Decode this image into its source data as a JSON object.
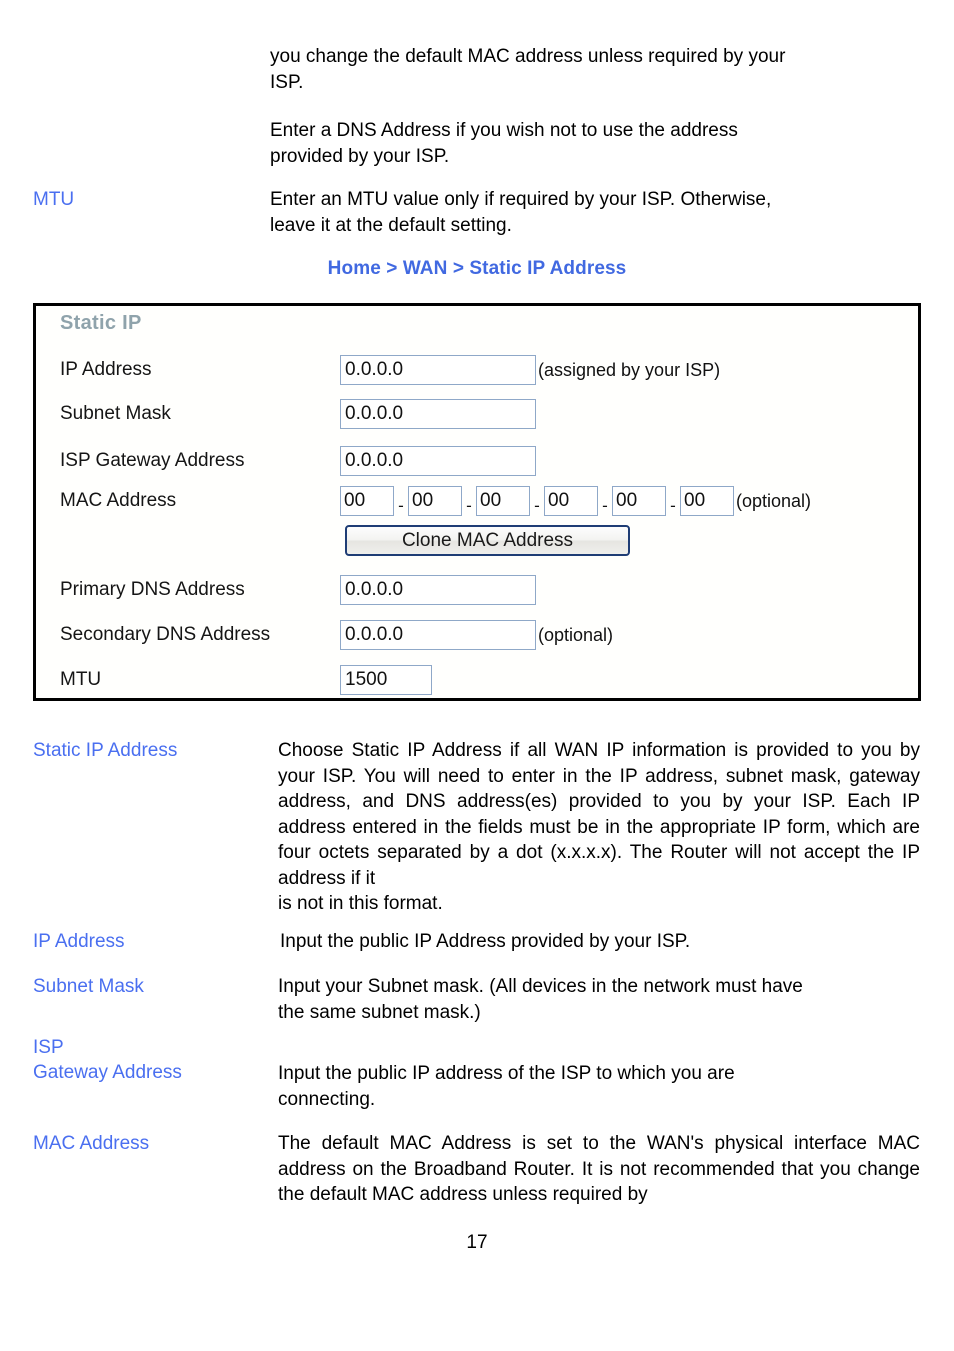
{
  "document": {
    "page_number": "17",
    "accent_term_color": "#4a6ff0",
    "breadcrumb_color": "#4169e1",
    "panel_title_color": "#8fa3ab",
    "input_border_color": "#8fa8c8",
    "button_border_color": "#1f3d75"
  },
  "top_paragraphs": [
    {
      "body": "you change the default MAC address unless required by your",
      "last_line": "ISP."
    },
    {
      "body": "Enter a DNS Address if you wish not to use the address",
      "last_line": "provided by    your ISP."
    }
  ],
  "mtu_row": {
    "term": "MTU",
    "body": "Enter an MTU value only if required by your ISP. Otherwise,",
    "last_line": "leave it at the default setting."
  },
  "breadcrumb": "Home > WAN > Static IP Address",
  "panel": {
    "title": "Static IP",
    "rows": {
      "ip_address": {
        "label": "IP Address",
        "value": "0.0.0.0",
        "note": "(assigned by your ISP)"
      },
      "subnet_mask": {
        "label": "Subnet Mask",
        "value": "0.0.0.0",
        "note": ""
      },
      "isp_gateway_address": {
        "label": "ISP Gateway Address",
        "value": "0.0.0.0",
        "note": ""
      },
      "mac_address": {
        "label": "MAC Address",
        "octets": [
          "00",
          "00",
          "00",
          "00",
          "00",
          "00"
        ],
        "separator": "-",
        "note": "(optional)"
      },
      "clone_mac_button": "Clone MAC Address",
      "primary_dns_address": {
        "label": "Primary DNS Address",
        "value": "0.0.0.0",
        "note": ""
      },
      "secondary_dns_address": {
        "label": "Secondary DNS Address",
        "value": "0.0.0.0",
        "note": "(optional)"
      },
      "mtu": {
        "label": "MTU",
        "value": "1500",
        "note": ""
      }
    }
  },
  "descriptions": [
    {
      "term": "Static IP Address",
      "body": "Choose Static IP Address if all WAN IP information is provided to you by your ISP. You will need to enter in the IP address, subnet mask, gateway address, and DNS address(es) provided to you by your ISP. Each IP address entered in the fields must be in the appropriate IP form, which are four octets separated by a dot (x.x.x.x). The Router will not accept the IP address if it",
      "last_line": "is not in this format."
    },
    {
      "term": "IP Address",
      "body": "Input the public IP Address provided by your ISP.",
      "last_line": ""
    },
    {
      "term": "Subnet Mask",
      "body": "Input your Subnet mask. (All devices in the network must have",
      "last_line": "the same subnet mask.)"
    },
    {
      "term": "ISP\nGateway Address",
      "body": "Input the public IP address of the ISP to which you are",
      "last_line": "connecting."
    },
    {
      "term": "MAC Address",
      "body": "The default MAC Address is set to the WAN's physical interface MAC address on the Broadband Router. It is not recommended that you change the default MAC address unless required by",
      "last_line": ""
    }
  ]
}
